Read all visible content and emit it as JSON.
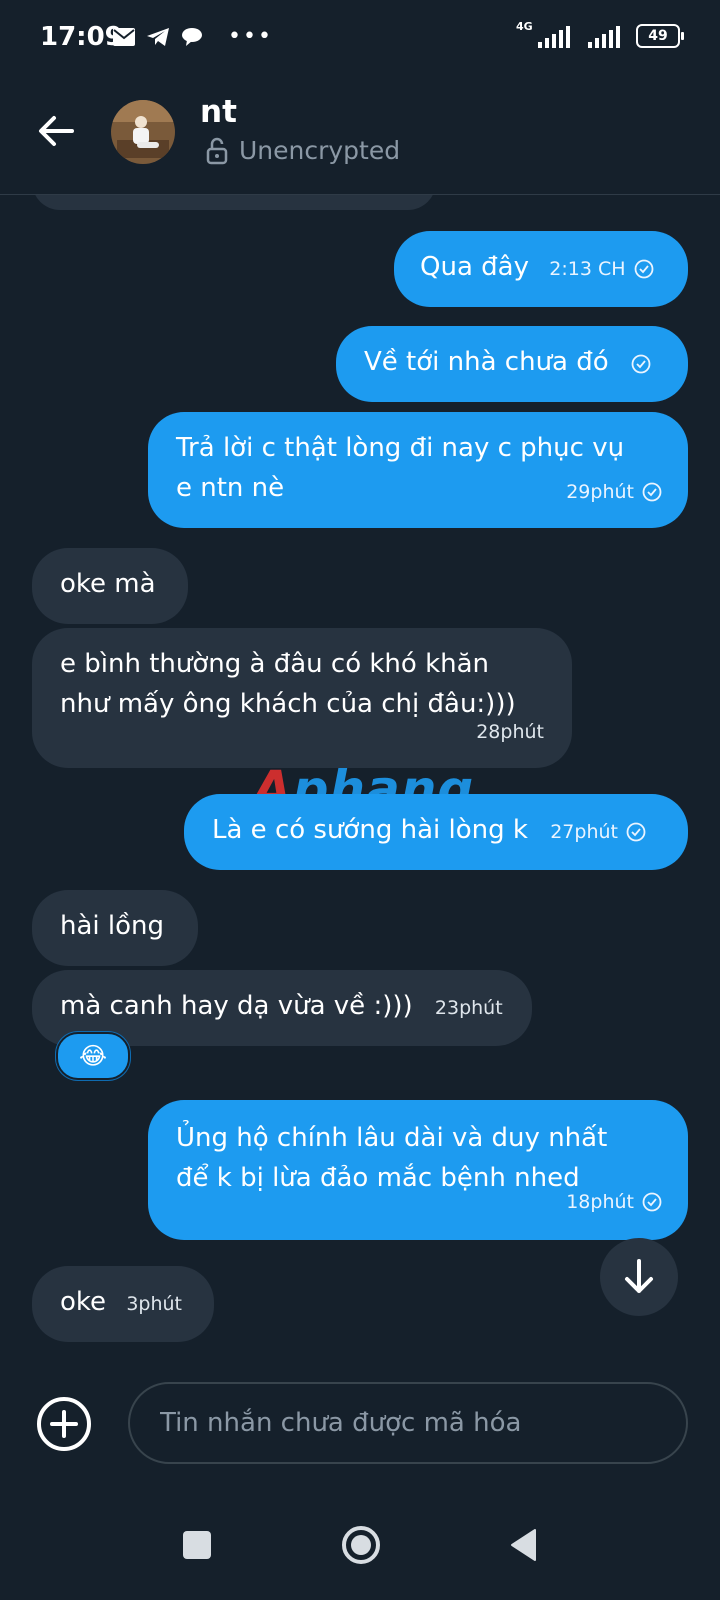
{
  "status_bar": {
    "time": "17:09",
    "network_type": "4G",
    "battery_level": "49",
    "notification_icons": [
      "mail-icon",
      "telegram-icon",
      "chat-icon"
    ],
    "overflow": "•••"
  },
  "header": {
    "contact_name": "nt",
    "encryption_status": "Unencrypted"
  },
  "messages": [
    {
      "direction": "outgoing",
      "text": "Qua đây",
      "time": "2:13 CH"
    },
    {
      "direction": "outgoing",
      "text": "Về tới nhà chưa đó",
      "time": ""
    },
    {
      "direction": "outgoing",
      "text": "Trả lời c thật lòng đi nay c phục vụ e ntn nè",
      "time": "29phút"
    },
    {
      "direction": "incoming",
      "text": "oke mà",
      "time": ""
    },
    {
      "direction": "incoming",
      "text": "e bình thường à đâu có khó khăn như mấy ông khách của chị đâu:)))",
      "time": "28phút"
    },
    {
      "direction": "outgoing",
      "text": "Là e có sướng hài lòng k",
      "time": "27phút"
    },
    {
      "direction": "incoming",
      "text": "hài lồng",
      "time": ""
    },
    {
      "direction": "incoming",
      "text": "mà canh hay dạ vừa về :)))",
      "time": "23phút",
      "reaction": "😂"
    },
    {
      "direction": "outgoing",
      "text": "Ủng hộ chính lâu dài và duy nhất để k bị lừa đảo mắc bệnh nhed",
      "time": "18phút"
    },
    {
      "direction": "incoming",
      "text": "oke",
      "time": "3phút"
    }
  ],
  "watermark": {
    "part1": "A",
    "part2": "phang"
  },
  "composer": {
    "placeholder": "Tin nhắn chưa được mã hóa"
  },
  "colors": {
    "background": "#15202b",
    "outgoing_bubble": "#1d9bf0",
    "incoming_bubble": "#273340",
    "muted_text": "#8b98a5"
  }
}
